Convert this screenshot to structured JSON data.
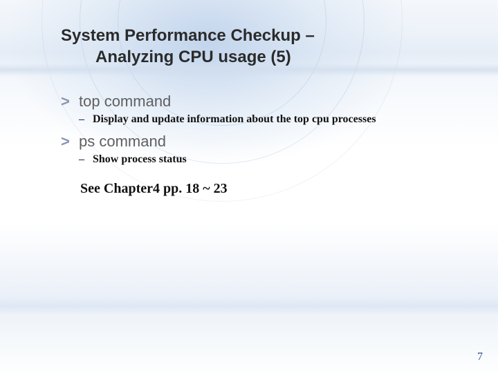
{
  "title": {
    "line1": "System Performance Checkup –",
    "line2": "Analyzing CPU usage (5)"
  },
  "bullets": [
    {
      "heading": "top command",
      "sub": "Display and update information about the top cpu processes"
    },
    {
      "heading": "ps command",
      "sub": "Show process status"
    }
  ],
  "note": "See Chapter4  pp. 18 ~ 23",
  "markers": {
    "level1": ">",
    "level2": "–"
  },
  "pageNumber": "7"
}
